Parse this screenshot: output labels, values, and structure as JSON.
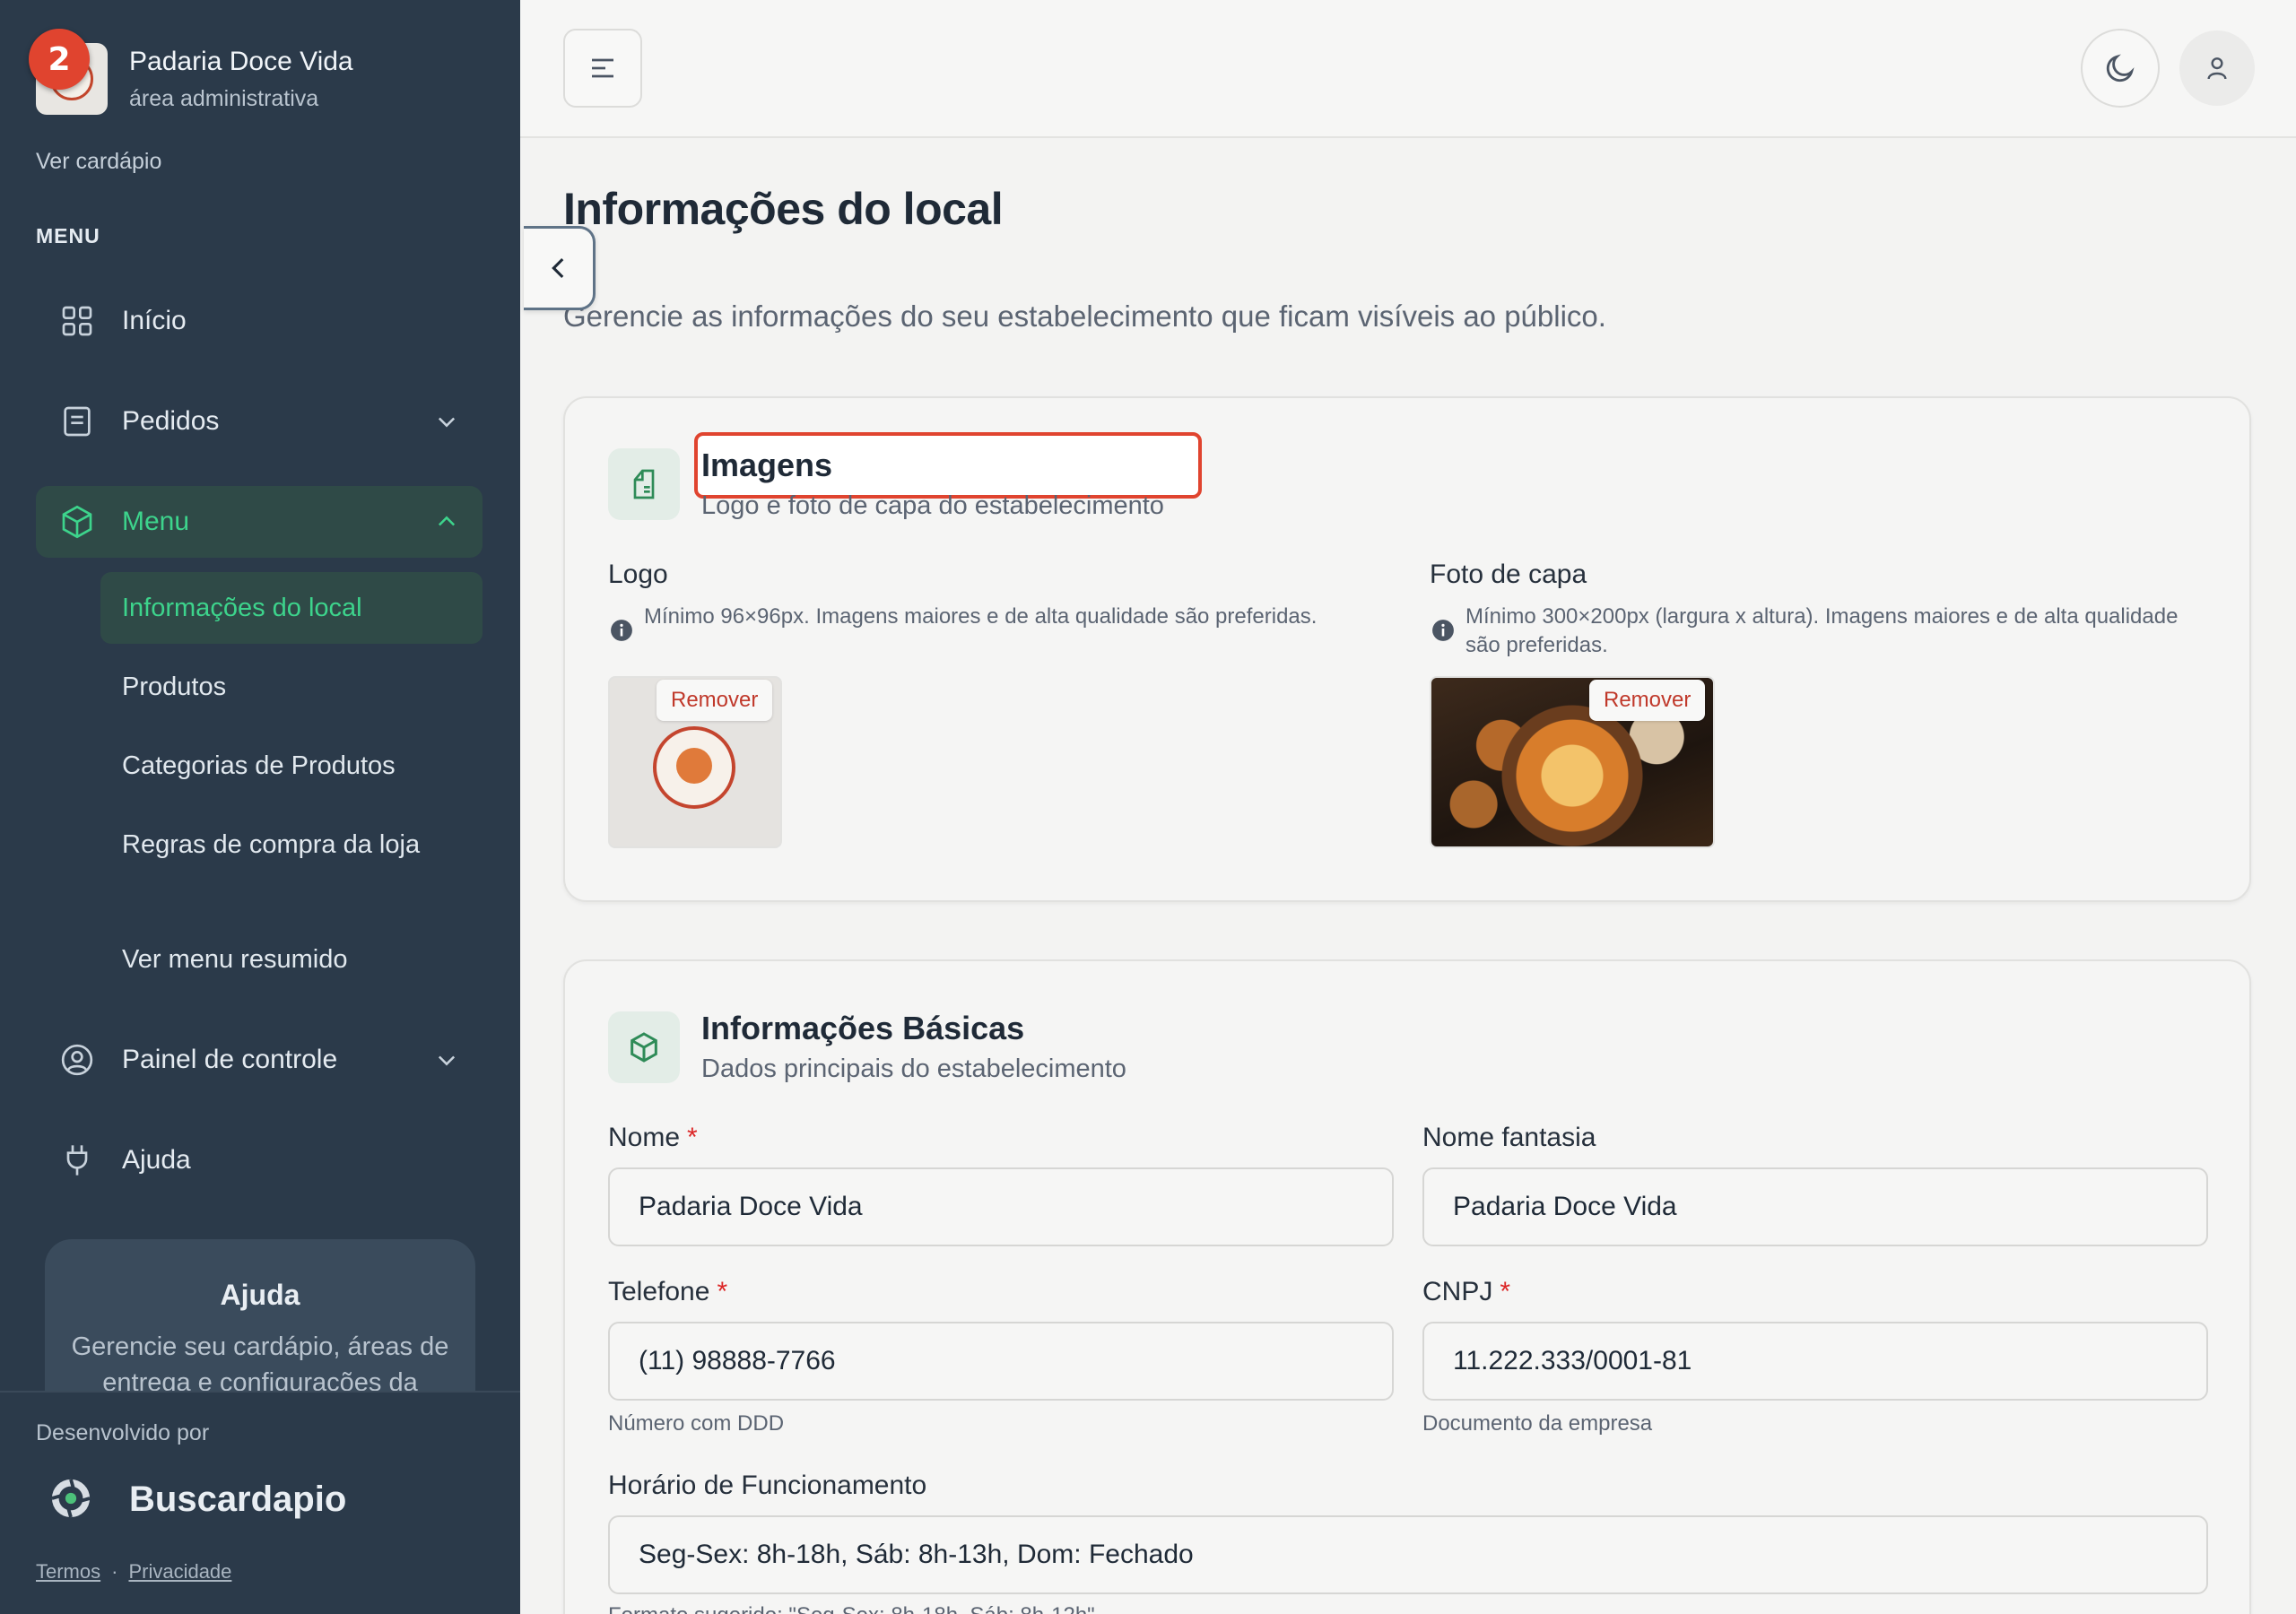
{
  "brand": {
    "name": "Padaria Doce Vida",
    "subtitle": "área administrativa",
    "notification_count": "2"
  },
  "sidebar": {
    "view_menu_link": "Ver cardápio",
    "menu_heading": "MENU",
    "items": [
      {
        "label": "Início",
        "icon": "grid-icon"
      },
      {
        "label": "Pedidos",
        "icon": "receipt-icon"
      },
      {
        "label": "Menu",
        "icon": "box-icon"
      },
      {
        "label": "Painel de controle",
        "icon": "user-circle-icon"
      },
      {
        "label": "Ajuda",
        "icon": "plug-icon"
      }
    ],
    "menu_subitems": [
      {
        "label": "Informações do local"
      },
      {
        "label": "Produtos"
      },
      {
        "label": "Categorias de Produtos"
      },
      {
        "label": "Regras de compra da loja"
      },
      {
        "label": "Ver menu resumido"
      }
    ],
    "help_card": {
      "title": "Ajuda",
      "text": "Gerencie seu cardápio, áreas de entrega e configurações da"
    },
    "developed_by": "Desenvolvido por",
    "developer_name": "Buscardapio",
    "footer": {
      "terms": "Termos",
      "separator": "·",
      "privacy": "Privacidade"
    }
  },
  "page": {
    "title": "Informações do local",
    "description": "Gerencie as informações do seu estabelecimento que ficam visíveis ao público."
  },
  "images_card": {
    "title": "Imagens",
    "subtitle": "Logo e foto de capa do estabelecimento",
    "logo": {
      "label": "Logo",
      "hint": "Mínimo 96×96px. Imagens maiores e de alta qualidade são preferidas.",
      "remove_label": "Remover"
    },
    "cover": {
      "label": "Foto de capa",
      "hint": "Mínimo 300×200px (largura x altura). Imagens maiores e de alta qualidade são preferidas.",
      "remove_label": "Remover"
    }
  },
  "basic_card": {
    "title": "Informações Básicas",
    "subtitle": "Dados principais do estabelecimento",
    "required_mark": "*",
    "fields": {
      "nome": {
        "label": "Nome",
        "value": "Padaria Doce Vida"
      },
      "nome_fantasia": {
        "label": "Nome fantasia",
        "value": "Padaria Doce Vida"
      },
      "telefone": {
        "label": "Telefone",
        "value": "(11) 98888-7766",
        "help": "Número com DDD"
      },
      "cnpj": {
        "label": "CNPJ",
        "value": "11.222.333/0001-81",
        "help": "Documento da empresa"
      },
      "horario": {
        "label": "Horário de Funcionamento",
        "value": "Seg-Sex: 8h-18h, Sáb: 8h-13h, Dom: Fechado",
        "help": "Formato sugerido: \"Seg-Sex: 8h-18h, Sáb: 8h-12h\""
      }
    }
  },
  "colors": {
    "sidebar_bg": "#2b3a4a",
    "accent_green": "#3dd48c",
    "highlight_red": "#e0442f",
    "required_red": "#dc2626"
  }
}
